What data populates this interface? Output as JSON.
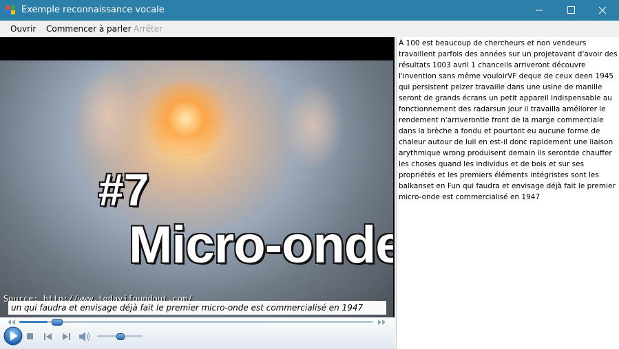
{
  "window": {
    "title": "Exemple reconnaissance vocale",
    "accent": "#2b7fa8"
  },
  "icons": {
    "app": "app-window-icon",
    "minimize": "minimize-icon",
    "maximize": "maximize-icon",
    "close": "close-icon"
  },
  "menu": {
    "open_label": "Ouvrir",
    "start_label": "Commencer à parler",
    "stop_label": "Arrêter"
  },
  "video": {
    "number_text": "#7",
    "title_text": "Micro-onde",
    "source_text": "Source: http://www.todayifoundout.com/",
    "caption_text": "un qui faudra et envisage déjà fait le premier micro-onde est commercialisé en 1947"
  },
  "player": {
    "seek_progress": 0.08,
    "volume_level": 0.5,
    "controls": [
      "play-icon",
      "stop-icon",
      "previous-icon",
      "next-icon",
      "volume-icon"
    ]
  },
  "transcript": {
    "text": "À 100 est beaucoup de chercheurs et non vendeurs travaillent parfois des années sur un projetavant d'avoir des résultats 1003 avril 1 chanceils arriveront découvre l'invention sans même vouloirVF deque de ceux deen 1945 qui persistent pelzer travaille dans une usine de manille seront de grands écrans un petit appareil indispensable au fonctionnement des radarsun jour il travailla améliorer le rendement n'arriverontle front de la marge commerciale dans la brèche a fondu et pourtant eu aucune forme de chaleur autour de luil en est-il donc rapidement une liaison arythmique wrong produisent demain ils serontde chauffer les choses quand les individus et de bois et sur ses propriétés et les premiers éléments intégristes sont les balkanset en Fun qui faudra et envisage déjà fait le premier micro-onde est commercialisé en 1947"
  }
}
